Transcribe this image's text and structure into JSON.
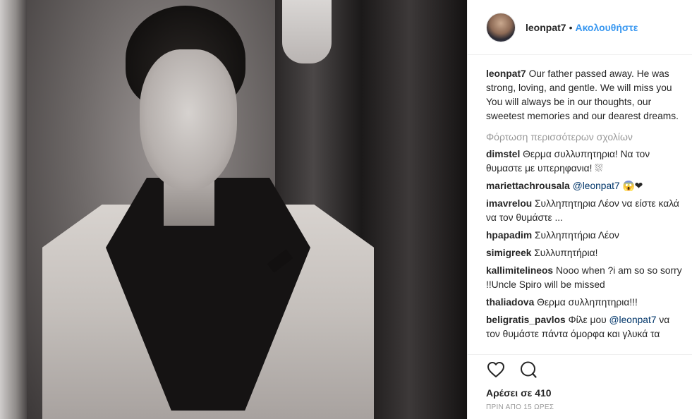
{
  "post": {
    "author": "leonpat7",
    "separator": "•",
    "follow_label": "Ακολουθήστε",
    "photo_alt": "",
    "caption": {
      "user": "leonpat7",
      "text": "Our father passed away. He was strong, loving, and gentle. We will miss you You will always be in our thoughts, our sweetest memories and our dearest dreams."
    },
    "load_more": "Φόρτωση περισσότερων σχολίων",
    "comments": [
      {
        "user": "dimstel",
        "text": "Θερμα συλλυπητηρια! Να τον θυμαστε με υπερηφανια! ⛆"
      },
      {
        "user": "mariettachrousala",
        "mention": "@leonpat7",
        "text": "😱❤"
      },
      {
        "user": "imavrelou",
        "text": "Συλληπητηρια Λέον να είστε καλά να τον θυμάστε ..."
      },
      {
        "user": "hpapadim",
        "text": "Συλληπητήρια Λέον"
      },
      {
        "user": "simigreek",
        "text": "Συλλυπητήρια!"
      },
      {
        "user": "kallimitelineos",
        "text": "Nooo when ?i am so so sorry !!Uncle Spiro will be missed"
      },
      {
        "user": "thaliadova",
        "text": "Θερμα συλληπητηρια!!!"
      },
      {
        "user": "beligratis_pavlos",
        "text": "Φίλε μου",
        "mention": "@leonpat7",
        "text2": "να τον θυμάστε πάντα όμορφα και γλυκά τα"
      }
    ],
    "likes": "Αρέσει σε 410",
    "timestamp": "ΠΡΙΝ ΑΠΟ 15 ΩΡΕΣ"
  },
  "colors": {
    "link": "#3897f0",
    "mention": "#003569",
    "muted": "#999999",
    "text": "#262626",
    "border": "#efefef"
  },
  "icons": {
    "like": "heart-icon",
    "comment": "comment-bubble-icon"
  }
}
